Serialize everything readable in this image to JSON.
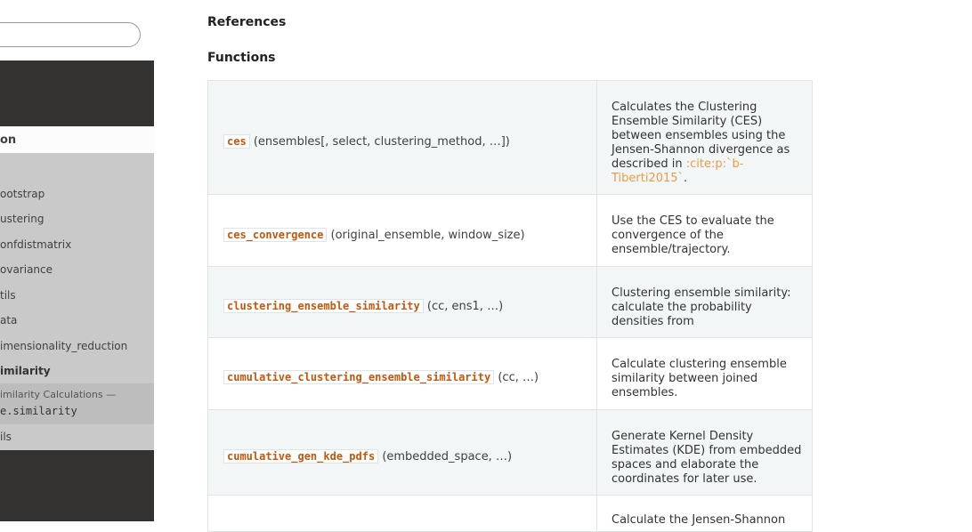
{
  "sidebar": {
    "current_section": "on",
    "items": [
      {
        "label": "ootstrap"
      },
      {
        "label": "ustering"
      },
      {
        "label": "onfdistmatrix"
      },
      {
        "label": "ovariance"
      },
      {
        "label": "tils"
      },
      {
        "label": "ata"
      },
      {
        "label": "imensionality_reduction"
      },
      {
        "label": "imilarity"
      }
    ],
    "active_item": {
      "line1": "imilarity Calculations —",
      "line2": "e.similarity"
    },
    "after_item": "ils"
  },
  "main": {
    "headings": {
      "references": "References",
      "functions": "Functions"
    },
    "functions": [
      {
        "name": "ces",
        "args": "(ensembles[, select, clustering_method, …])",
        "desc": "Calculates the Clustering Ensemble Similarity (CES) between ensembles using the Jensen-Shannon divergence as described in",
        "cite": ":cite:p:`b-Tiberti2015`",
        "desc_end": "."
      },
      {
        "name": "ces_convergence",
        "args": "(original_ensemble, window_size)",
        "desc": "Use the CES to evaluate the convergence of the ensemble/trajectory."
      },
      {
        "name": "clustering_ensemble_similarity",
        "args": "(cc, ens1, …)",
        "desc": "Clustering ensemble similarity: calculate the probability densities from"
      },
      {
        "name": "cumulative_clustering_ensemble_similarity",
        "args": "(cc, …)",
        "desc": "Calculate clustering ensemble similarity between joined ensembles."
      },
      {
        "name": "cumulative_gen_kde_pdfs",
        "args": "(embedded_space, …)",
        "desc": "Generate Kernel Density Estimates (KDE) from embedded spaces and elaborate the coordinates for later use."
      },
      {
        "name": "",
        "args": "",
        "desc": "Calculate the Jensen-Shannon"
      }
    ]
  }
}
